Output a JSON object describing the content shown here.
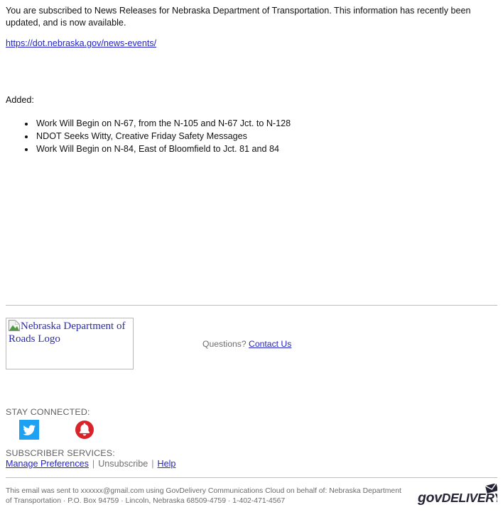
{
  "message": {
    "intro": "You are subscribed to News Releases for Nebraska Department of Transportation. This information has recently been updated, and is now available.",
    "link_text": "https://dot.nebraska.gov/news-events/",
    "added_label": "Added:",
    "added_items": [
      "Work Will Begin on N-67, from the N-105 and N-67 Jct. to N-128",
      "NDOT Seeks Witty, Creative Friday Safety Messages",
      "Work Will Begin on N-84, East of Bloomfield to Jct. 81 and 84"
    ]
  },
  "footer": {
    "logo_alt_text": "Nebraska Department of Roads Logo",
    "questions_label": "Questions?",
    "contact_link": "Contact Us",
    "stay_connected_label": "STAY CONNECTED:",
    "social": [
      {
        "name": "twitter-icon",
        "label": "Twitter",
        "color": "#1da1f2"
      },
      {
        "name": "bell-icon",
        "label": "Notifications",
        "color": "#d9232a"
      }
    ],
    "subscriber_services_label": "SUBSCRIBER SERVICES:",
    "manage_preferences": "Manage Preferences",
    "separator": "|",
    "unsubscribe": "Unsubscribe",
    "help": "Help",
    "disclaimer": "This email was sent to xxxxxx@gmail.com using GovDelivery Communications Cloud on behalf of: Nebraska Department of Transportation · P.O. Box 94759 · Lincoln, Nebraska 68509-4759 · 1-402-471-4567",
    "govdelivery_logo_text": "govDELIVERY"
  },
  "colors": {
    "link": "#2222cc",
    "alt_text": "#2a2ab0",
    "muted": "#6e6e6e",
    "divider": "#bdbdbd",
    "twitter": "#1da1f2",
    "bell": "#d9232a",
    "govdelivery": "#242436"
  }
}
